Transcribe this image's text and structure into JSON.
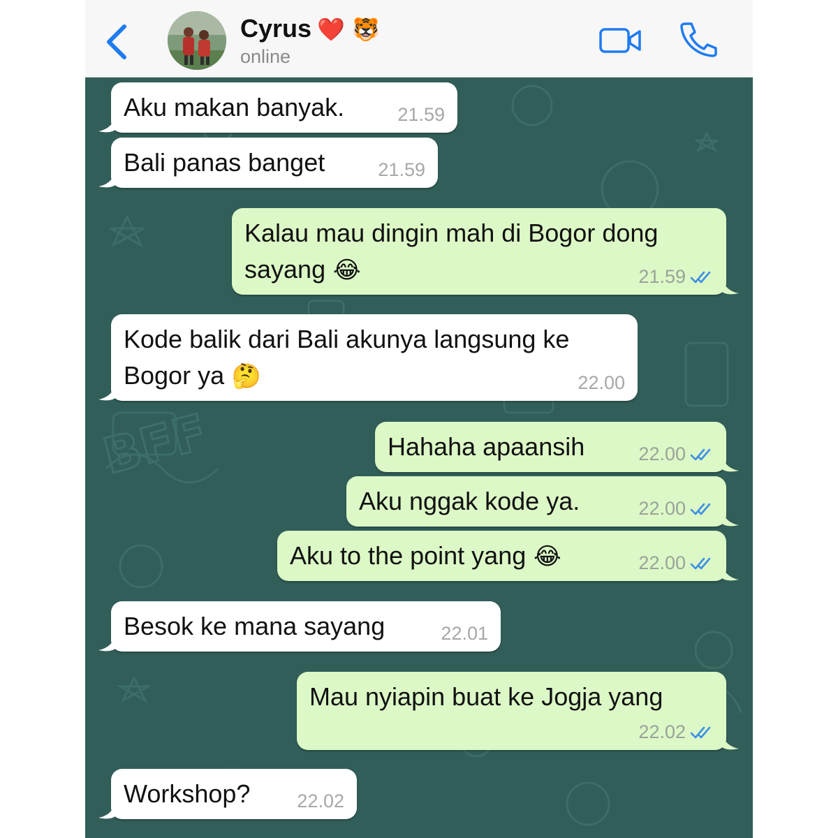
{
  "header": {
    "contact_name": "Cyrus",
    "contact_emoji": "❤️ 🐯",
    "status": "online",
    "icons": [
      "back-chevron-icon",
      "video-call-icon",
      "phone-icon"
    ]
  },
  "colors": {
    "accent": "#1e7bf1",
    "wallpaper": "#315e59",
    "outgoing_bubble": "#dcf8c6",
    "incoming_bubble": "#ffffff",
    "read_ticks": "#3b8ee6"
  },
  "messages": [
    {
      "dir": "in",
      "text": "Aku makan banyak.",
      "time": "21.59"
    },
    {
      "dir": "in",
      "text": "Bali panas banget",
      "time": "21.59"
    },
    {
      "dir": "out",
      "text": "Kalau mau dingin mah di Bogor dong\nsayang",
      "emoji": "😂",
      "time": "21.59",
      "read": true
    },
    {
      "dir": "in",
      "text": "Kode balik dari Bali akunya langsung ke\nBogor ya",
      "emoji": "🤔",
      "time": "22.00"
    },
    {
      "dir": "out",
      "text": "Hahaha apaansih",
      "time": "22.00",
      "read": true
    },
    {
      "dir": "out",
      "text": "Aku nggak kode ya.",
      "time": "22.00",
      "read": true
    },
    {
      "dir": "out",
      "text": "Aku to the point yang",
      "emoji": "😂",
      "time": "22.00",
      "read": true
    },
    {
      "dir": "in",
      "text": "Besok ke mana sayang",
      "time": "22.01"
    },
    {
      "dir": "out",
      "text": "Mau nyiapin buat ke Jogja yang",
      "time": "22.02",
      "read": true
    },
    {
      "dir": "in",
      "text": "Workshop?",
      "time": "22.02"
    }
  ]
}
